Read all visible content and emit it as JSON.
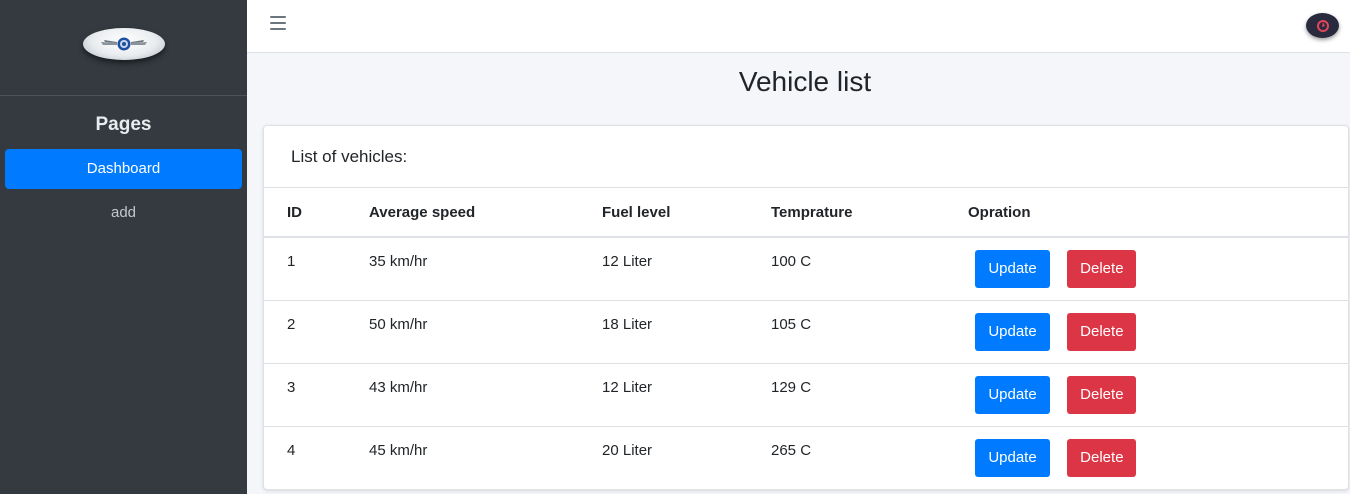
{
  "sidebar": {
    "section_title": "Pages",
    "items": [
      {
        "label": "Dashboard"
      },
      {
        "label": "add"
      }
    ]
  },
  "topbar": {
    "menu_icon": "hamburger-menu-icon",
    "avatar_icon": "user-avatar-icon"
  },
  "main": {
    "title": "Vehicle list",
    "card_header": "List of vehicles:",
    "columns": [
      "ID",
      "Average speed",
      "Fuel level",
      "Temprature",
      "Opration"
    ],
    "rows": [
      {
        "id": "1",
        "speed": "35 km/hr",
        "fuel": "12 Liter",
        "temp": "100 C"
      },
      {
        "id": "2",
        "speed": "50 km/hr",
        "fuel": "18 Liter",
        "temp": "105 C"
      },
      {
        "id": "3",
        "speed": "43 km/hr",
        "fuel": "12 Liter",
        "temp": "129 C"
      },
      {
        "id": "4",
        "speed": "45 km/hr",
        "fuel": "20 Liter",
        "temp": "265 C"
      }
    ],
    "update_label": "Update",
    "delete_label": "Delete"
  },
  "colors": {
    "sidebar_bg": "#343a40",
    "primary": "#007bff",
    "danger": "#dc3545"
  }
}
